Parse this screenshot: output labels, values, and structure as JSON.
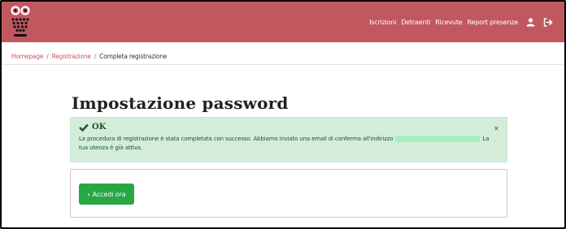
{
  "nav": {
    "items": [
      "Iscrizioni",
      "Detraenti",
      "Ricevute",
      "Report presenze"
    ],
    "brand_color": "#c1585f",
    "icons": [
      "user-icon",
      "logout-icon"
    ]
  },
  "breadcrumb": {
    "home": "Homepage",
    "section": "Registrazione",
    "separator": "/",
    "current": "Completa registrazione"
  },
  "page": {
    "title": "Impostazione password"
  },
  "alert": {
    "title": "OK",
    "close": "×",
    "text_before": "La procedura di registrazione è stata completata con successo. Abbiamo inviato una email di conferma all'indirizzo",
    "text_after": "La tua utenza è già attiva.",
    "color": "#d4edda"
  },
  "card": {
    "button_label": "Accedi ora",
    "button_chevron": "›",
    "button_color": "#28a745"
  }
}
